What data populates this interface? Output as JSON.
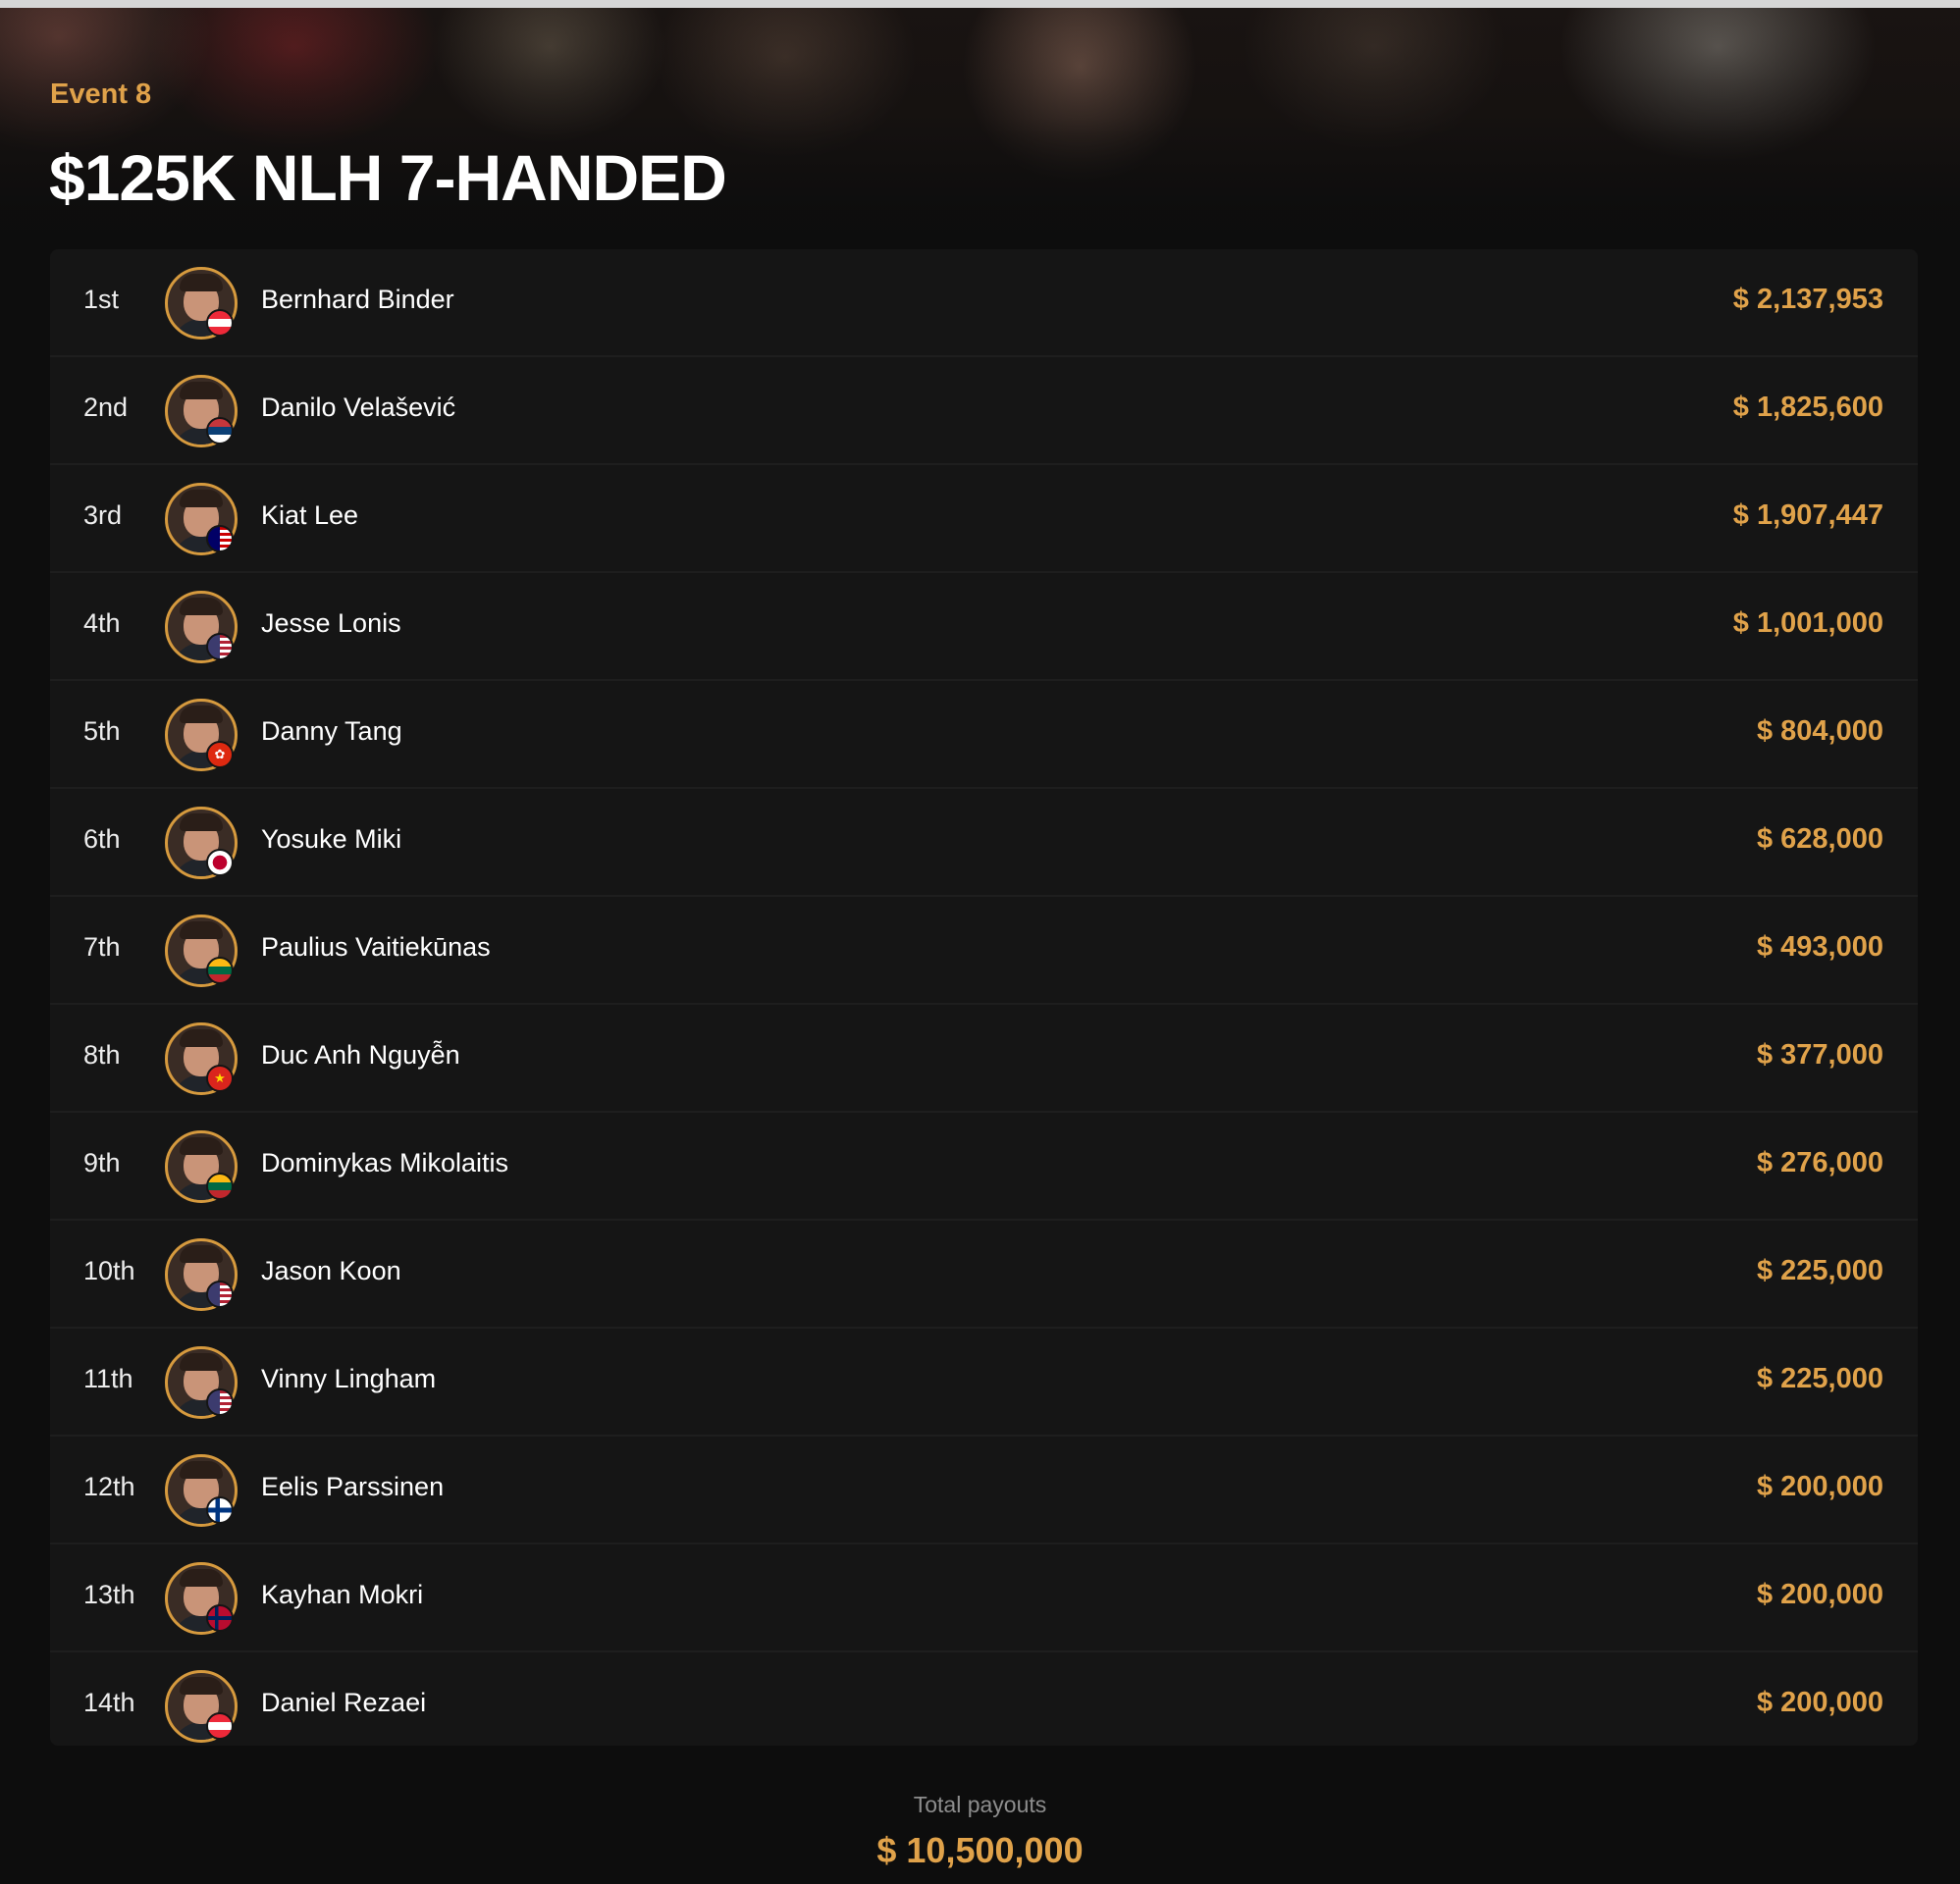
{
  "header": {
    "event_label": "Event 8",
    "title": "$125K NLH 7-HANDED"
  },
  "colors": {
    "accent": "#e0a24a",
    "background": "#0d0d0d",
    "row_background": "#151515",
    "text": "#ffffff"
  },
  "results": [
    {
      "rank": "1st",
      "name": "Bernhard Binder",
      "prize": "$ 2,137,953",
      "flag": "austria-flag-icon"
    },
    {
      "rank": "2nd",
      "name": "Danilo Velašević",
      "prize": "$ 1,825,600",
      "flag": "serbia-flag-icon"
    },
    {
      "rank": "3rd",
      "name": "Kiat Lee",
      "prize": "$ 1,907,447",
      "flag": "malaysia-flag-icon"
    },
    {
      "rank": "4th",
      "name": "Jesse Lonis",
      "prize": "$ 1,001,000",
      "flag": "usa-flag-icon"
    },
    {
      "rank": "5th",
      "name": "Danny Tang",
      "prize": "$ 804,000",
      "flag": "hong-kong-flag-icon"
    },
    {
      "rank": "6th",
      "name": "Yosuke Miki",
      "prize": "$ 628,000",
      "flag": "japan-flag-icon"
    },
    {
      "rank": "7th",
      "name": "Paulius Vaitiekūnas",
      "prize": "$ 493,000",
      "flag": "lithuania-flag-icon"
    },
    {
      "rank": "8th",
      "name": "Duc Anh Nguyễn",
      "prize": "$ 377,000",
      "flag": "vietnam-flag-icon"
    },
    {
      "rank": "9th",
      "name": "Dominykas Mikolaitis",
      "prize": "$ 276,000",
      "flag": "lithuania-flag-icon"
    },
    {
      "rank": "10th",
      "name": "Jason Koon",
      "prize": "$ 225,000",
      "flag": "usa-flag-icon"
    },
    {
      "rank": "11th",
      "name": "Vinny Lingham",
      "prize": "$ 225,000",
      "flag": "usa-flag-icon"
    },
    {
      "rank": "12th",
      "name": "Eelis Parssinen",
      "prize": "$ 200,000",
      "flag": "finland-flag-icon"
    },
    {
      "rank": "13th",
      "name": "Kayhan Mokri",
      "prize": "$ 200,000",
      "flag": "norway-flag-icon"
    },
    {
      "rank": "14th",
      "name": "Daniel Rezaei",
      "prize": "$ 200,000",
      "flag": "austria-flag-icon"
    }
  ],
  "footer": {
    "total_label": "Total payouts",
    "total_value": "$ 10,500,000"
  }
}
